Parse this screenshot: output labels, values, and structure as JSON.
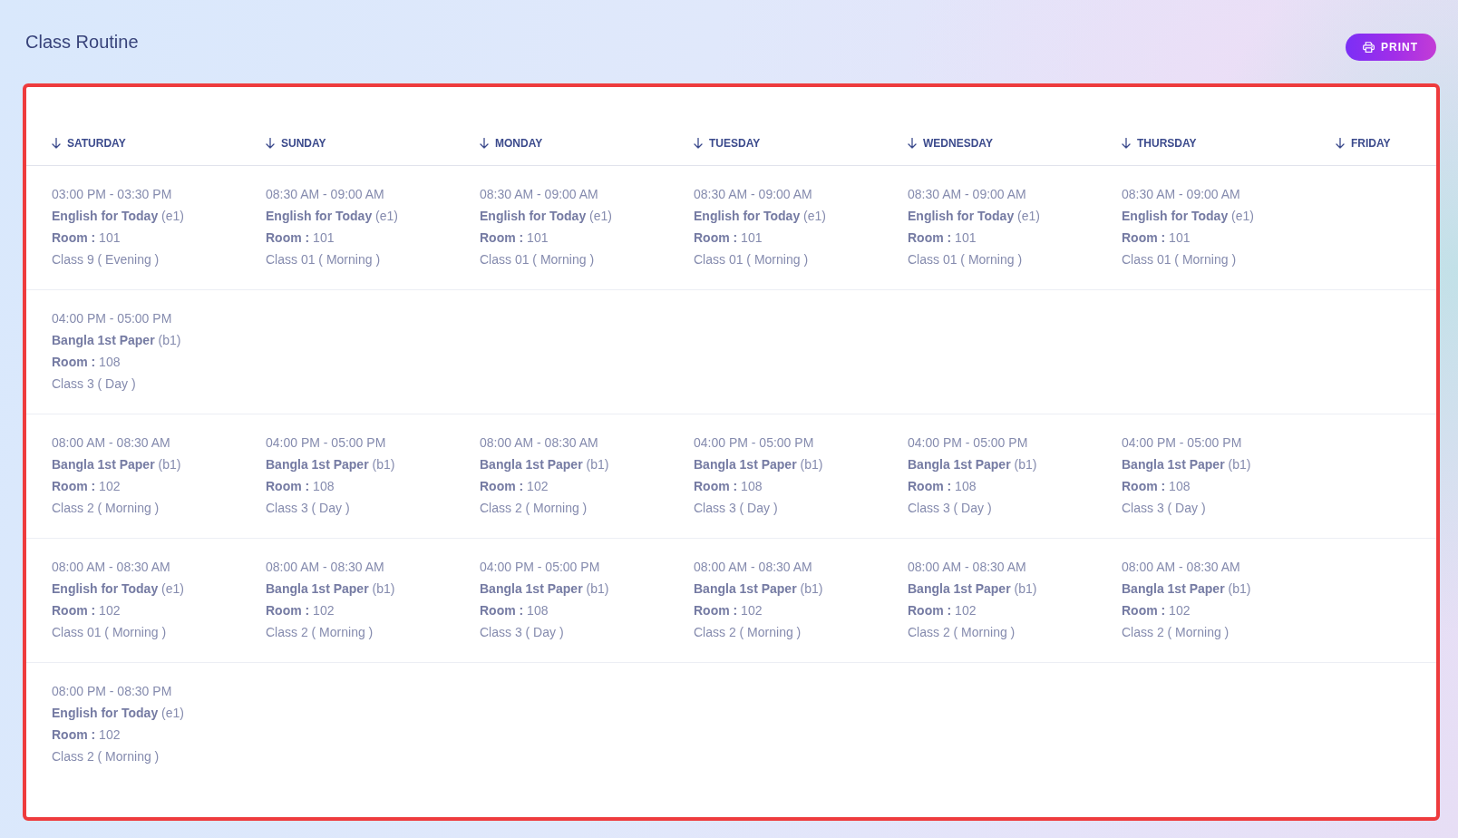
{
  "page": {
    "title": "Class Routine"
  },
  "print_button": {
    "label": "PRINT"
  },
  "routine": {
    "columns": [
      {
        "label": "SATURDAY"
      },
      {
        "label": "SUNDAY"
      },
      {
        "label": "MONDAY"
      },
      {
        "label": "TUESDAY"
      },
      {
        "label": "WEDNESDAY"
      },
      {
        "label": "THURSDAY"
      },
      {
        "label": "FRIDAY"
      }
    ],
    "rows": [
      {
        "cells": [
          {
            "time": "03:00 PM - 03:30 PM",
            "subject": "**English for Today** (e1)",
            "room": "**Room :** 101",
            "class": "Class 9 ( Evening )"
          },
          {
            "time": "08:30 AM - 09:00 AM",
            "subject": "**English for Today** (e1)",
            "room": "**Room :** 101",
            "class": "Class 01 ( Morning )"
          },
          {
            "time": "08:30 AM - 09:00 AM",
            "subject": "**English for Today** (e1)",
            "room": "**Room :** 101",
            "class": "Class 01 ( Morning )"
          },
          {
            "time": "08:30 AM - 09:00 AM",
            "subject": "**English for Today** (e1)",
            "room": "**Room :** 101",
            "class": "Class 01 ( Morning )"
          },
          {
            "time": "08:30 AM - 09:00 AM",
            "subject": "**English for Today** (e1)",
            "room": "**Room :** 101",
            "class": "Class 01 ( Morning )"
          },
          {
            "time": "08:30 AM - 09:00 AM",
            "subject": "**English for Today** (e1)",
            "room": "**Room :** 101",
            "class": "Class 01 ( Morning )"
          }
        ]
      },
      {
        "cells": [
          {
            "time": "04:00 PM - 05:00 PM",
            "subject": "**Bangla 1st Paper** (b1)",
            "room": "**Room :** 108",
            "class": "Class 3 ( Day )"
          }
        ]
      },
      {
        "cells": [
          {
            "time": "08:00 AM - 08:30 AM",
            "subject": "**Bangla 1st Paper** (b1)",
            "room": "**Room :** 102",
            "class": "Class 2 ( Morning )"
          },
          {
            "time": "04:00 PM - 05:00 PM",
            "subject": "**Bangla 1st Paper** (b1)",
            "room": "**Room :** 108",
            "class": "Class 3 ( Day )"
          },
          {
            "time": "08:00 AM - 08:30 AM",
            "subject": "**Bangla 1st Paper** (b1)",
            "room": "**Room :** 102",
            "class": "Class 2 ( Morning )"
          },
          {
            "time": "04:00 PM - 05:00 PM",
            "subject": "**Bangla 1st Paper** (b1)",
            "room": "**Room :** 108",
            "class": "Class 3 ( Day )"
          },
          {
            "time": "04:00 PM - 05:00 PM",
            "subject": "**Bangla 1st Paper** (b1)",
            "room": "**Room :** 108",
            "class": "Class 3 ( Day )"
          },
          {
            "time": "04:00 PM - 05:00 PM",
            "subject": "**Bangla 1st Paper** (b1)",
            "room": "**Room :** 108",
            "class": "Class 3 ( Day )"
          }
        ]
      },
      {
        "cells": [
          {
            "time": "08:00 AM - 08:30 AM",
            "subject": "**English for Today** (e1)",
            "room": "**Room :** 102",
            "class": "Class 01 ( Morning )"
          },
          {
            "time": "08:00 AM - 08:30 AM",
            "subject": "**Bangla 1st Paper** (b1)",
            "room": "**Room :** 102",
            "class": "Class 2 ( Morning )"
          },
          {
            "time": "04:00 PM - 05:00 PM",
            "subject": "**Bangla 1st Paper** (b1)",
            "room": "**Room :** 108",
            "class": "Class 3 ( Day )"
          },
          {
            "time": "08:00 AM - 08:30 AM",
            "subject": "**Bangla 1st Paper** (b1)",
            "room": "**Room :** 102",
            "class": "Class 2 ( Morning )"
          },
          {
            "time": "08:00 AM - 08:30 AM",
            "subject": "**Bangla 1st Paper** (b1)",
            "room": "**Room :** 102",
            "class": "Class 2 ( Morning )"
          },
          {
            "time": "08:00 AM - 08:30 AM",
            "subject": "**Bangla 1st Paper** (b1)",
            "room": "**Room :** 102",
            "class": "Class 2 ( Morning )"
          }
        ]
      },
      {
        "cells": [
          {
            "time": "08:00 PM - 08:30 PM",
            "subject": "**English for Today** (e1)",
            "room": "**Room :** 102",
            "class": "Class 2 ( Morning )"
          }
        ]
      }
    ]
  }
}
